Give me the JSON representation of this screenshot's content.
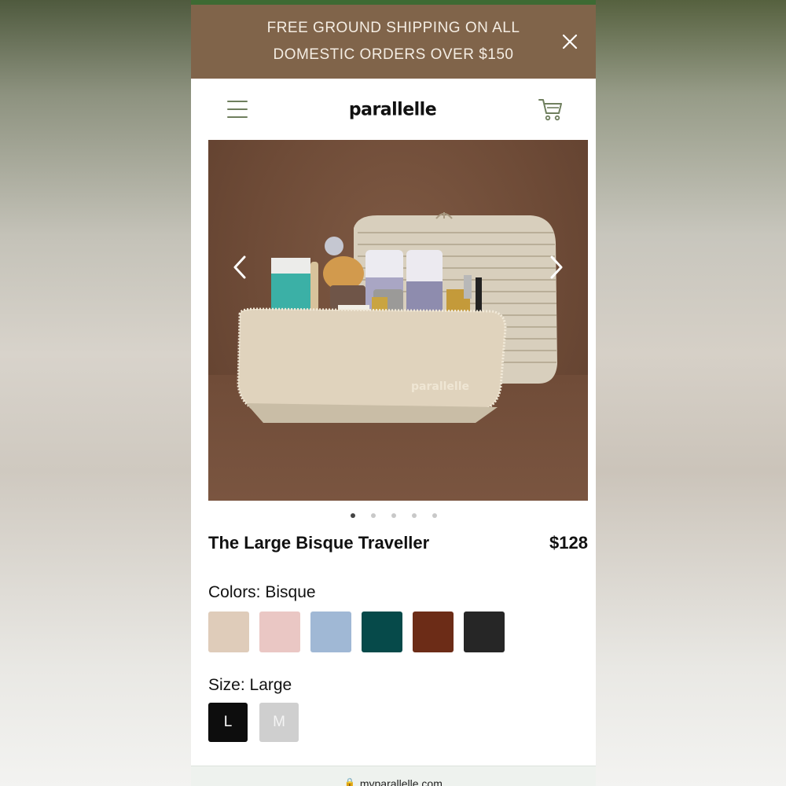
{
  "promo": {
    "text": "FREE GROUND SHIPPING ON ALL DOMESTIC ORDERS OVER $150"
  },
  "header": {
    "logo": "parallelle"
  },
  "gallery": {
    "image_watermark": "parallelle",
    "image_count": 5,
    "active_index": 0
  },
  "product": {
    "title": "The Large Bisque Traveller",
    "price": "$128"
  },
  "colors": {
    "label": "Colors: Bisque",
    "swatches": [
      {
        "name": "Bisque",
        "hex": "#dfccba"
      },
      {
        "name": "Pink",
        "hex": "#eac7c4"
      },
      {
        "name": "Blue",
        "hex": "#a0b8d5"
      },
      {
        "name": "Teal",
        "hex": "#064a4a"
      },
      {
        "name": "Brown",
        "hex": "#6c2c17"
      },
      {
        "name": "Black",
        "hex": "#262626"
      }
    ]
  },
  "size": {
    "label": "Size: Large",
    "options": [
      "L",
      "M"
    ],
    "selected": "L"
  },
  "browser": {
    "url": "myparallelle.com"
  },
  "theme": {
    "promo_bg": "#80644a",
    "accent_green": "#6f7f5e"
  }
}
